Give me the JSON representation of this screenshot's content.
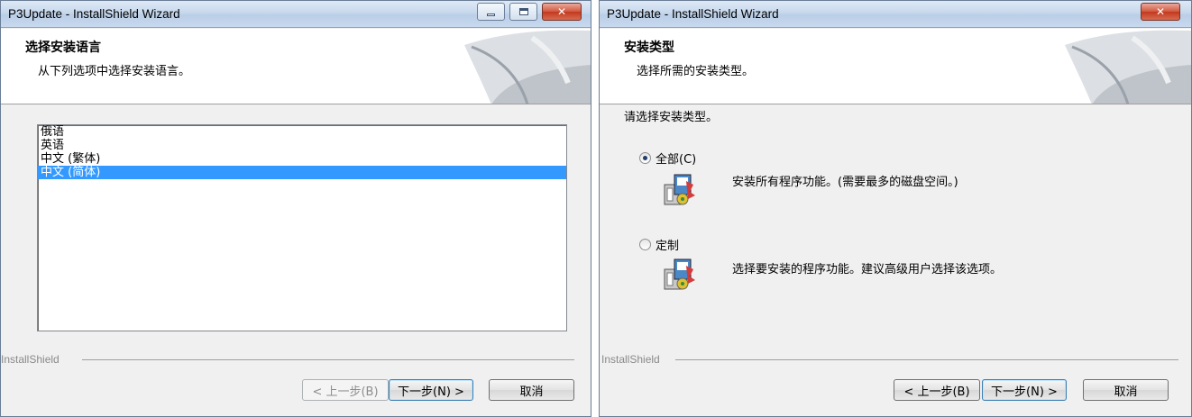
{
  "windows": [
    {
      "title": "P3Update - InstallShield Wizard",
      "header_title": "选择安装语言",
      "header_subtitle": "从下列选项中选择安装语言。",
      "languages": [
        "俄语",
        "英语",
        "中文 (繁体)",
        "中文 (简体)"
      ],
      "selected_language": "中文 (简体)",
      "brand": "InstallShield",
      "buttons": {
        "back": "< 上一步(B)",
        "next": "下一步(N) >",
        "cancel": "取消"
      }
    },
    {
      "title": "P3Update - InstallShield Wizard",
      "header_title": "安装类型",
      "header_subtitle": "选择所需的安装类型。",
      "prompt": "请选择安装类型。",
      "options": [
        {
          "label": "全部(C)",
          "description": "安装所有程序功能。(需要最多的磁盘空间。)",
          "selected": true
        },
        {
          "label": "定制",
          "description": "选择要安装的程序功能。建议高级用户选择该选项。",
          "selected": false
        }
      ],
      "brand": "InstallShield",
      "buttons": {
        "back": "< 上一步(B)",
        "next": "下一步(N) >",
        "cancel": "取消"
      }
    }
  ],
  "icons": [
    "minimize-icon",
    "maximize-icon",
    "close-icon",
    "installshield-banner-art",
    "install-package-icon"
  ],
  "colors": {
    "selection": "#3399ff",
    "titlebar": "#c4d6ec",
    "close_button": "#c2391f",
    "dialog_bg": "#f0f0f0"
  }
}
